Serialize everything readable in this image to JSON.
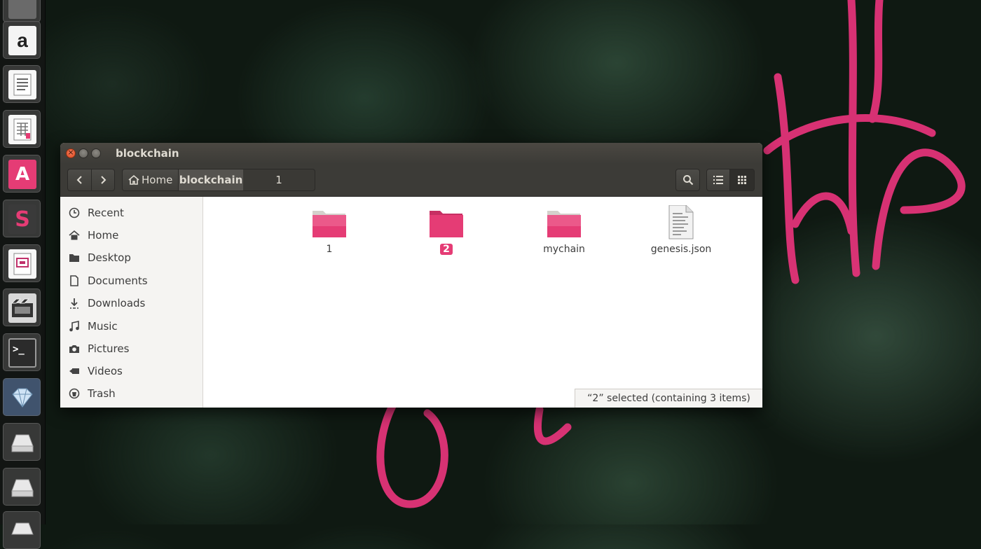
{
  "window": {
    "title": "blockchain",
    "buttons": {
      "close": "×"
    }
  },
  "toolbar": {
    "back_glyph": "‹",
    "forward_glyph": "›",
    "path": [
      {
        "label": "Home",
        "icon": "home-icon"
      },
      {
        "label": "blockchain"
      },
      {
        "label": "1"
      }
    ]
  },
  "sidebar": {
    "items": [
      {
        "label": "Recent",
        "icon": "clock-icon"
      },
      {
        "label": "Home",
        "icon": "home-icon"
      },
      {
        "label": "Desktop",
        "icon": "folder-icon"
      },
      {
        "label": "Documents",
        "icon": "document-icon"
      },
      {
        "label": "Downloads",
        "icon": "download-icon"
      },
      {
        "label": "Music",
        "icon": "music-icon"
      },
      {
        "label": "Pictures",
        "icon": "camera-icon"
      },
      {
        "label": "Videos",
        "icon": "video-icon"
      },
      {
        "label": "Trash",
        "icon": "trash-icon"
      }
    ]
  },
  "files": [
    {
      "name": "1",
      "type": "folder",
      "selected": false
    },
    {
      "name": "2",
      "type": "folder",
      "selected": true
    },
    {
      "name": "mychain",
      "type": "folder",
      "selected": false
    },
    {
      "name": "genesis.json",
      "type": "text-file",
      "selected": false
    }
  ],
  "status": {
    "text": "“2” selected  (containing 3 items)"
  },
  "launcher": {
    "apps": [
      "amazon-icon",
      "writer-icon",
      "calc-icon",
      "software-center-icon",
      "sublime-icon",
      "impress-icon",
      "video-editor-icon",
      "terminal-icon",
      "gem-icon",
      "disk-icon",
      "disk-icon",
      "disk-icon"
    ],
    "amazon_glyph": "a",
    "software_center_glyph": "A",
    "sublime_glyph": "S",
    "terminal_glyph": ">_"
  },
  "colors": {
    "accent": "#e53c75",
    "titlebar": "#3c3b37",
    "close": "#df4b20"
  }
}
